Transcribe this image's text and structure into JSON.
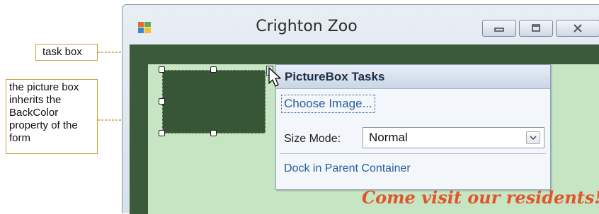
{
  "window": {
    "title": "Crighton Zoo",
    "icon": "app-icon",
    "buttons": [
      "minimize-icon",
      "maximize-icon",
      "close-icon"
    ]
  },
  "form": {
    "back_color": "#3b5a3b",
    "client_color": "#c7e4c3",
    "promo_text": "Come visit our residents!",
    "promo_color": "#e0562a"
  },
  "task_box": {
    "title": "PictureBox Tasks",
    "choose_image": "Choose Image...",
    "size_mode_label": "Size Mode:",
    "size_mode_value": "Normal",
    "dock_link": "Dock in Parent Container"
  },
  "callouts": {
    "task_box": "task box",
    "picture_box": "the picture box inherits the BackColor property of the form"
  }
}
